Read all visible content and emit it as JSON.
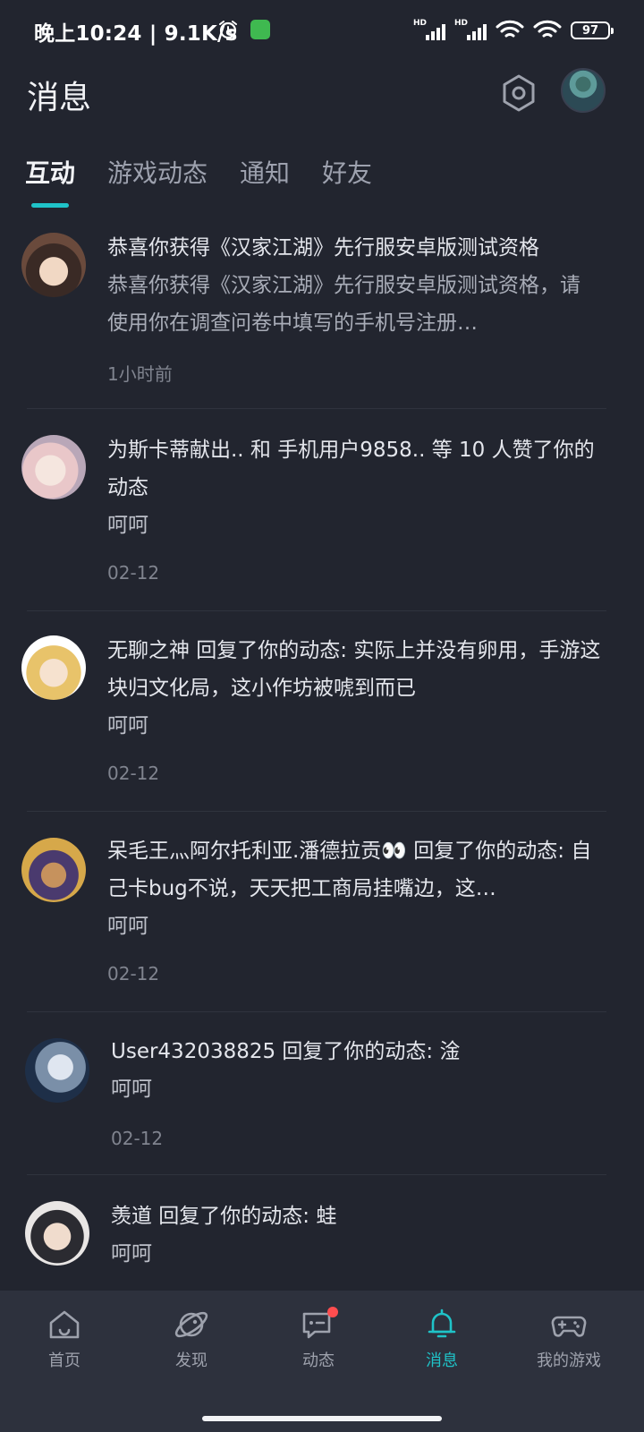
{
  "status_bar": {
    "time": "晚上10:24 | 9.1K/s",
    "battery": "97"
  },
  "header": {
    "title": "消息"
  },
  "tabs": [
    {
      "label": "互动",
      "active": true
    },
    {
      "label": "游戏动态",
      "active": false
    },
    {
      "label": "通知",
      "active": false
    },
    {
      "label": "好友",
      "active": false
    }
  ],
  "messages": [
    {
      "title": "恭喜你获得《汉家江湖》先行服安卓版测试资格",
      "body": "恭喜你获得《汉家江湖》先行服安卓版测试资格，请使用你在调查问卷中填写的手机号注册…",
      "time": "1小时前"
    },
    {
      "text": "为斯卡蒂献出.. 和 手机用户9858.. 等 10 人赞了你的动态",
      "sub": "呵呵",
      "time": "02-12"
    },
    {
      "text": "无聊之神 回复了你的动态: 实际上并没有卵用，手游这块归文化局，这小作坊被唬到而已",
      "sub": "呵呵",
      "time": "02-12"
    },
    {
      "text": "呆毛王灬阿尔托利亚.潘德拉贡👀 回复了你的动态: 自己卡bug不说，天天把工商局挂嘴边，这…",
      "sub": "呵呵",
      "time": "02-12"
    },
    {
      "text": "User432038825 回复了你的动态: 淦",
      "sub": "呵呵",
      "time": "02-12"
    },
    {
      "text": "羡道 回复了你的动态: 蛙",
      "sub": "呵呵",
      "time": ""
    }
  ],
  "bottom_nav": [
    {
      "label": "首页",
      "icon": "home-icon"
    },
    {
      "label": "发现",
      "icon": "planet-icon"
    },
    {
      "label": "动态",
      "icon": "chat-icon"
    },
    {
      "label": "消息",
      "icon": "bell-icon"
    },
    {
      "label": "我的游戏",
      "icon": "gamepad-icon"
    }
  ],
  "colors": {
    "background": "#22252f",
    "accent": "#1fc3c8",
    "nav_background": "#2d313d",
    "badge": "#ff4d4f"
  }
}
